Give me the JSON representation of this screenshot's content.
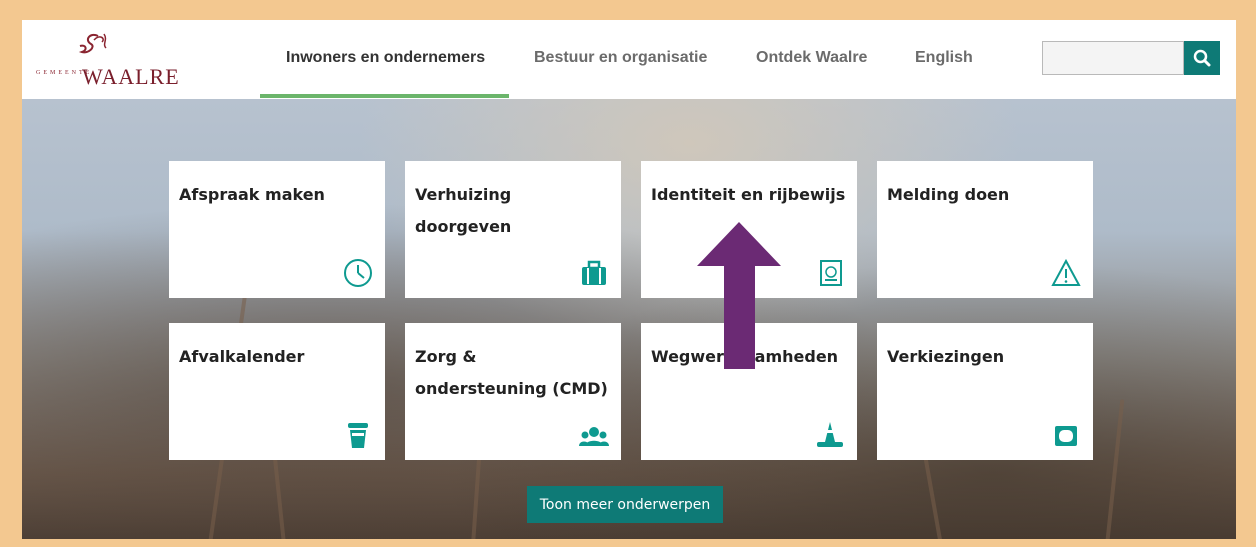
{
  "logo": {
    "small_text": "GEMEENTE",
    "big_text": "WAALRE",
    "colors": {
      "primary": "#7a1f2c"
    }
  },
  "nav": {
    "items": [
      {
        "label": "Inwoners en ondernemers",
        "active": true
      },
      {
        "label": "Bestuur en organisatie",
        "active": false
      },
      {
        "label": "Ontdek Waalre",
        "active": false
      },
      {
        "label": "English",
        "active": false
      }
    ],
    "underline_color": "#6bb56b"
  },
  "search": {
    "value": "",
    "placeholder": "",
    "button_icon": "search-icon",
    "button_color": "#0e7a76"
  },
  "tiles": [
    {
      "title": "Afspraak maken",
      "icon": "clock-icon"
    },
    {
      "title": "Verhuizing doorgeven",
      "icon": "briefcase-icon"
    },
    {
      "title": "Identiteit en rijbewijs",
      "icon": "passport-icon"
    },
    {
      "title": "Melding doen",
      "icon": "warning-icon"
    },
    {
      "title": "Afvalkalender",
      "icon": "trash-icon"
    },
    {
      "title": "Zorg & ondersteuning (CMD)",
      "icon": "people-icon"
    },
    {
      "title": "Wegwerkzaamheden",
      "icon": "roadwork-cone-icon"
    },
    {
      "title": "Verkiezingen",
      "icon": "ballot-box-icon"
    }
  ],
  "more_button": {
    "label": "Toon meer onderwerpen"
  },
  "accent_color": "#0e9a90",
  "annotation": {
    "icon": "arrow-up-icon",
    "color": "#6b2a74"
  }
}
